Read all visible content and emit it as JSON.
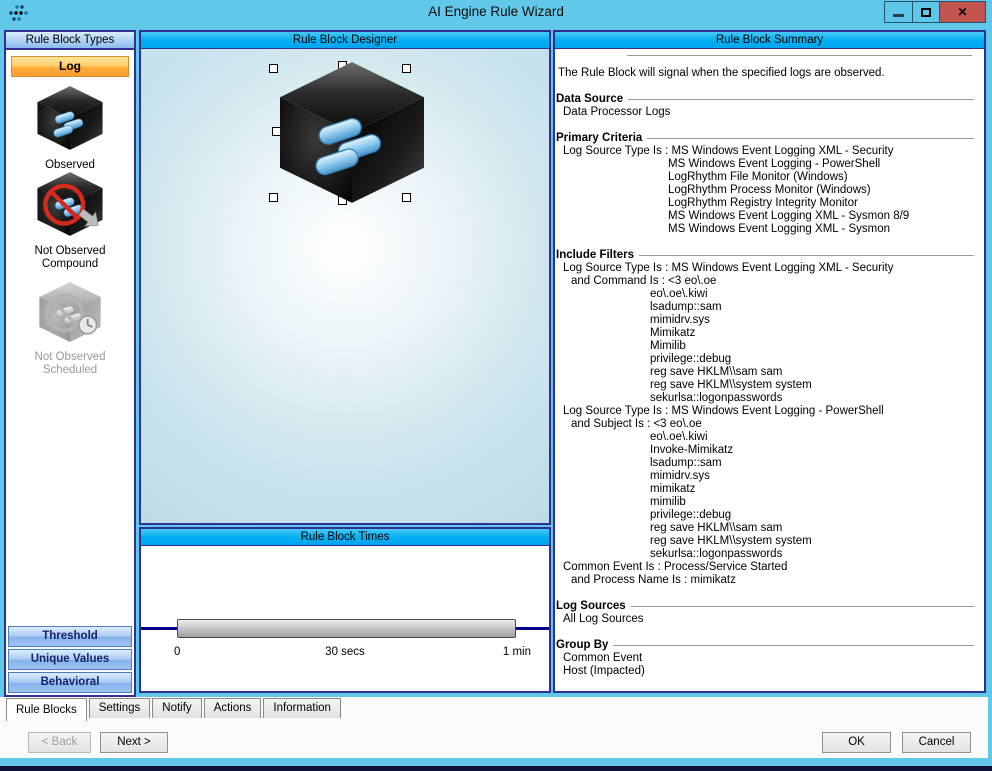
{
  "window": {
    "title": "AI Engine Rule Wizard",
    "icons": {
      "minimize": "minimize-dash",
      "maximize": "maximize-square",
      "close": "✕"
    }
  },
  "colors": {
    "title_bar": "#61c8e9",
    "panel_header_blue": "#00aef2",
    "panel_border_navy": "#2e3192",
    "close_button_red": "#c1544e",
    "log_button_orange": "#ffae3c",
    "slider_track_navy": "#00008b"
  },
  "sidebar": {
    "header": "Rule Block Types",
    "category_label": "Log",
    "types": [
      {
        "label": "Observed",
        "state": "selected"
      },
      {
        "label": "Not Observed Compound",
        "state": "enabled"
      },
      {
        "label": "Not Observed Scheduled",
        "state": "disabled"
      }
    ],
    "bottom_buttons": [
      {
        "label": "Threshold"
      },
      {
        "label": "Unique Values"
      },
      {
        "label": "Behavioral"
      }
    ]
  },
  "designer": {
    "header": "Rule Block Designer"
  },
  "times": {
    "header": "Rule Block Times",
    "ticks": [
      "0",
      "30 secs",
      "1 min"
    ]
  },
  "summary": {
    "header": "Rule Block Summary",
    "intro": "The Rule Block will signal when the specified logs are observed.",
    "sections": [
      {
        "title": "Data Source",
        "lines": [
          {
            "t": "Data Processor Logs",
            "i": 0
          }
        ]
      },
      {
        "title": "Primary Criteria",
        "lines": [
          {
            "t": "Log Source Type Is : MS Windows Event Logging XML - Security",
            "i": 0
          },
          {
            "t": "MS Windows Event Logging - PowerShell",
            "i": 2
          },
          {
            "t": "LogRhythm File Monitor (Windows)",
            "i": 2
          },
          {
            "t": "LogRhythm Process Monitor (Windows)",
            "i": 2
          },
          {
            "t": "LogRhythm Registry Integrity Monitor",
            "i": 2
          },
          {
            "t": "MS Windows Event Logging XML - Sysmon 8/9",
            "i": 2
          },
          {
            "t": "MS Windows Event Logging XML - Sysmon",
            "i": 2
          }
        ]
      },
      {
        "title": "Include Filters",
        "lines": [
          {
            "t": "Log Source Type Is : MS Windows Event Logging XML - Security",
            "i": 0
          },
          {
            "t": "and Command Is : <3 eo\\.oe",
            "i": 1
          },
          {
            "t": "eo\\.oe\\.kiwi",
            "i": 3
          },
          {
            "t": "lsadump::sam",
            "i": 3
          },
          {
            "t": "mimidrv.sys",
            "i": 3
          },
          {
            "t": "Mimikatz",
            "i": 3
          },
          {
            "t": "Mimilib",
            "i": 3
          },
          {
            "t": "privilege::debug",
            "i": 3
          },
          {
            "t": "reg save HKLM\\\\sam sam",
            "i": 3
          },
          {
            "t": "reg save HKLM\\\\system system",
            "i": 3
          },
          {
            "t": "sekurlsa::logonpasswords",
            "i": 3
          },
          {
            "t": "Log Source Type Is : MS Windows Event Logging - PowerShell",
            "i": 0
          },
          {
            "t": "and Subject Is : <3 eo\\.oe",
            "i": 1
          },
          {
            "t": "eo\\.oe\\.kiwi",
            "i": 3
          },
          {
            "t": "Invoke-Mimikatz",
            "i": 3
          },
          {
            "t": "lsadump::sam",
            "i": 3
          },
          {
            "t": "mimidrv.sys",
            "i": 3
          },
          {
            "t": "mimikatz",
            "i": 3
          },
          {
            "t": "mimilib",
            "i": 3
          },
          {
            "t": "privilege::debug",
            "i": 3
          },
          {
            "t": "reg save HKLM\\\\sam sam",
            "i": 3
          },
          {
            "t": "reg save HKLM\\\\system system",
            "i": 3
          },
          {
            "t": "sekurlsa::logonpasswords",
            "i": 3
          },
          {
            "t": "Common Event Is : Process/Service Started",
            "i": 0
          },
          {
            "t": "and Process Name Is : mimikatz",
            "i": 1
          }
        ]
      },
      {
        "title": "Log Sources",
        "lines": [
          {
            "t": "All Log Sources",
            "i": 0
          }
        ]
      },
      {
        "title": "Group By",
        "lines": [
          {
            "t": "Common Event",
            "i": 0
          },
          {
            "t": "Host (Impacted)",
            "i": 0
          }
        ]
      }
    ]
  },
  "tabs": {
    "items": [
      {
        "label": "Rule Blocks",
        "active": true
      },
      {
        "label": "Settings",
        "active": false
      },
      {
        "label": "Notify",
        "active": false
      },
      {
        "label": "Actions",
        "active": false
      },
      {
        "label": "Information",
        "active": false
      }
    ]
  },
  "wizard_buttons": {
    "back": "< Back",
    "next": "Next >",
    "ok": "OK",
    "cancel": "Cancel"
  }
}
